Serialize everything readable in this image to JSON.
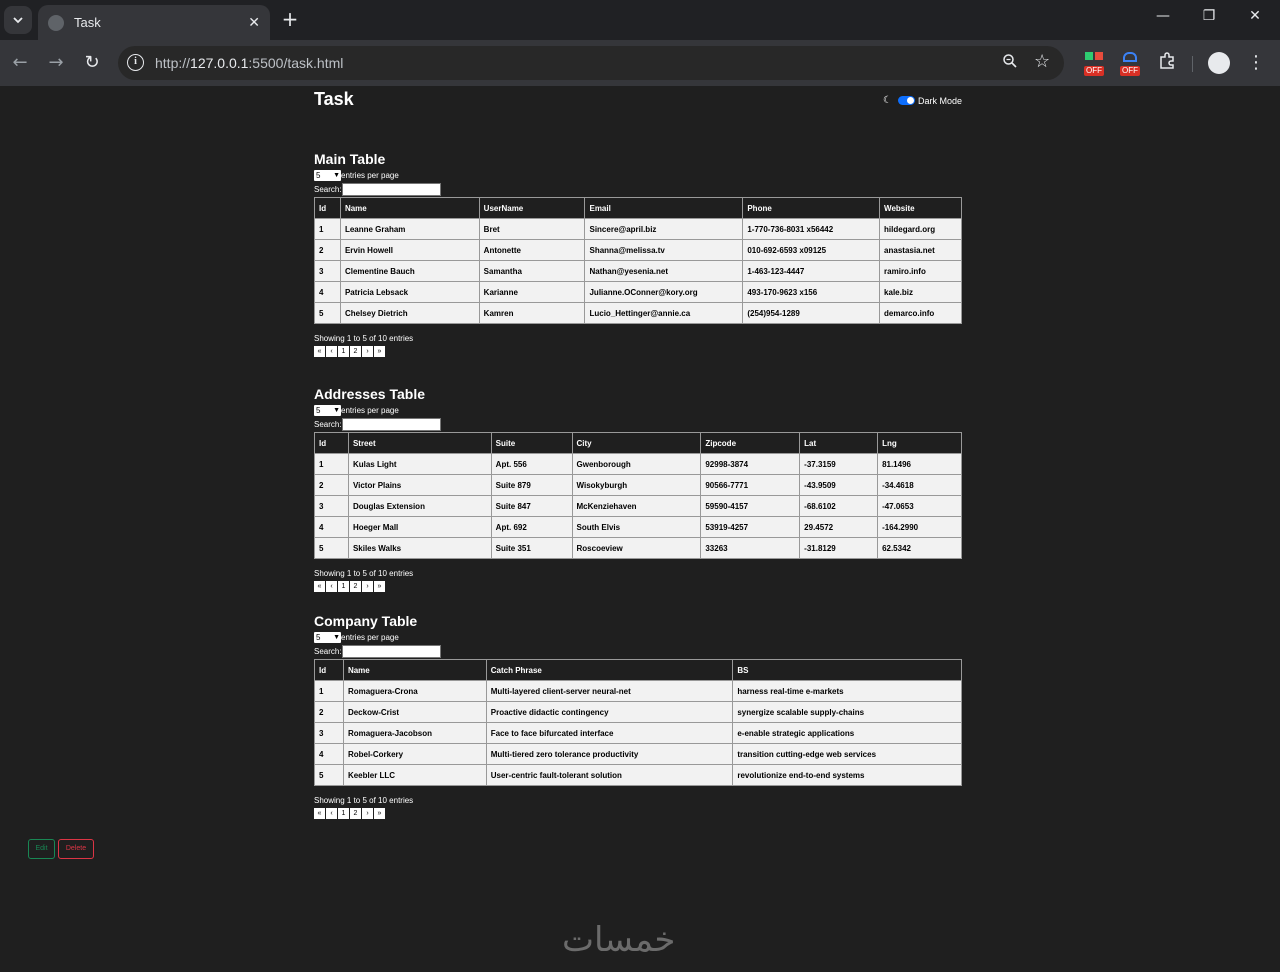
{
  "browser": {
    "tab_title": "Task",
    "url_prefix": "http://",
    "url_host": "127.0.0.1",
    "url_rest": ":5500/task.html",
    "ext_off_label": "OFF"
  },
  "page": {
    "title": "Task",
    "dark_mode_label": "Dark Mode",
    "entries_label": "entries per page",
    "search_label": "Search:",
    "entries_value": "5",
    "pager": [
      "«",
      "‹",
      "1",
      "2",
      "›",
      "»"
    ]
  },
  "main_table": {
    "title": "Main Table",
    "columns": [
      "Id",
      "Name",
      "UserName",
      "Email",
      "Phone",
      "Website"
    ],
    "rows": [
      [
        "1",
        "Leanne Graham",
        "Bret",
        "Sincere@april.biz",
        "1-770-736-8031 x56442",
        "hildegard.org"
      ],
      [
        "2",
        "Ervin Howell",
        "Antonette",
        "Shanna@melissa.tv",
        "010-692-6593 x09125",
        "anastasia.net"
      ],
      [
        "3",
        "Clementine Bauch",
        "Samantha",
        "Nathan@yesenia.net",
        "1-463-123-4447",
        "ramiro.info"
      ],
      [
        "4",
        "Patricia Lebsack",
        "Karianne",
        "Julianne.OConner@kory.org",
        "493-170-9623 x156",
        "kale.biz"
      ],
      [
        "5",
        "Chelsey Dietrich",
        "Kamren",
        "Lucio_Hettinger@annie.ca",
        "(254)954-1289",
        "demarco.info"
      ]
    ],
    "showing": "Showing 1 to 5 of 10 entries"
  },
  "addresses_table": {
    "title": "Addresses Table",
    "columns": [
      "Id",
      "Street",
      "Suite",
      "City",
      "Zipcode",
      "Lat",
      "Lng"
    ],
    "rows": [
      [
        "1",
        "Kulas Light",
        "Apt. 556",
        "Gwenborough",
        "92998-3874",
        "-37.3159",
        "81.1496"
      ],
      [
        "2",
        "Victor Plains",
        "Suite 879",
        "Wisokyburgh",
        "90566-7771",
        "-43.9509",
        "-34.4618"
      ],
      [
        "3",
        "Douglas Extension",
        "Suite 847",
        "McKenziehaven",
        "59590-4157",
        "-68.6102",
        "-47.0653"
      ],
      [
        "4",
        "Hoeger Mall",
        "Apt. 692",
        "South Elvis",
        "53919-4257",
        "29.4572",
        "-164.2990"
      ],
      [
        "5",
        "Skiles Walks",
        "Suite 351",
        "Roscoeview",
        "33263",
        "-31.8129",
        "62.5342"
      ]
    ],
    "showing": "Showing 1 to 5 of 10 entries"
  },
  "company_table": {
    "title": "Company Table",
    "columns": [
      "Id",
      "Name",
      "Catch Phrase",
      "BS"
    ],
    "rows": [
      [
        "1",
        "Romaguera-Crona",
        "Multi-layered client-server neural-net",
        "harness real-time e-markets"
      ],
      [
        "2",
        "Deckow-Crist",
        "Proactive didactic contingency",
        "synergize scalable supply-chains"
      ],
      [
        "3",
        "Romaguera-Jacobson",
        "Face to face bifurcated interface",
        "e-enable strategic applications"
      ],
      [
        "4",
        "Robel-Corkery",
        "Multi-tiered zero tolerance productivity",
        "transition cutting-edge web services"
      ],
      [
        "5",
        "Keebler LLC",
        "User-centric fault-tolerant solution",
        "revolutionize end-to-end systems"
      ]
    ],
    "showing": "Showing 1 to 5 of 10 entries"
  },
  "actions": {
    "edit_label": "Edit",
    "delete_label": "Delete"
  },
  "watermark": "خمسات",
  "colors": {
    "edit": "#198754",
    "delete": "#dc3545",
    "toggle": "#0d6efd"
  }
}
